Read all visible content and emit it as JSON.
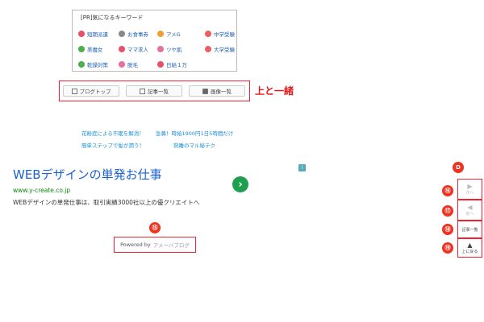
{
  "keywords": {
    "title": "[PR]気になるキーワード",
    "items": [
      {
        "label": "短期派遣",
        "icon": "person-icon",
        "color": "#e8506a"
      },
      {
        "label": "お食事券",
        "icon": "utensils-icon",
        "color": "#888888"
      },
      {
        "label": "アメG",
        "icon": "rainbow-icon",
        "color": "#f0a030"
      },
      {
        "label": "中学受験",
        "icon": "sakura-icon",
        "color": "#e86060"
      },
      {
        "label": "美魔女",
        "icon": "leaf-icon",
        "color": "#4cae4c"
      },
      {
        "label": "ママ求人",
        "icon": "person-icon",
        "color": "#e8506a"
      },
      {
        "label": "ツヤ肌",
        "icon": "heart-icon",
        "color": "#e870a0"
      },
      {
        "label": "大学受験",
        "icon": "sakura-icon",
        "color": "#e86060"
      },
      {
        "label": "乾燥対策",
        "icon": "leaf-icon",
        "color": "#4cae4c"
      },
      {
        "label": "脱毛",
        "icon": "heart-icon",
        "color": "#e870a0"
      },
      {
        "label": "日給１万",
        "icon": "person-icon",
        "color": "#e8506a"
      }
    ]
  },
  "blog_buttons": {
    "top": "ブログトップ",
    "articles": "記事一覧",
    "images": "画像一覧"
  },
  "annotation": "上と一緒",
  "text_links": [
    "花粉症による不眠を解消！",
    "急募！時給1900円1日5時間だけ",
    "簡単ステップで髪が潤う！",
    "熟睡のマル秘テク"
  ],
  "ad": {
    "title": "WEBデザインの単発お仕事",
    "url": "www.y-create.co.jp",
    "description": "WEBデザインの単発仕事は、取引実績3000社以上の優クリエイトへ",
    "info": "i"
  },
  "markers": {
    "m15": "⑮",
    "mD": "D",
    "m16": "⑯",
    "m17": "⑰",
    "m18": "⑱",
    "m19": "⑲"
  },
  "powered": {
    "prefix": "Powered by",
    "brand": "アメーバブログ"
  },
  "side_nav": {
    "next": "次へ",
    "prev": "前へ",
    "list": "記事一覧",
    "top": "上に戻る"
  }
}
